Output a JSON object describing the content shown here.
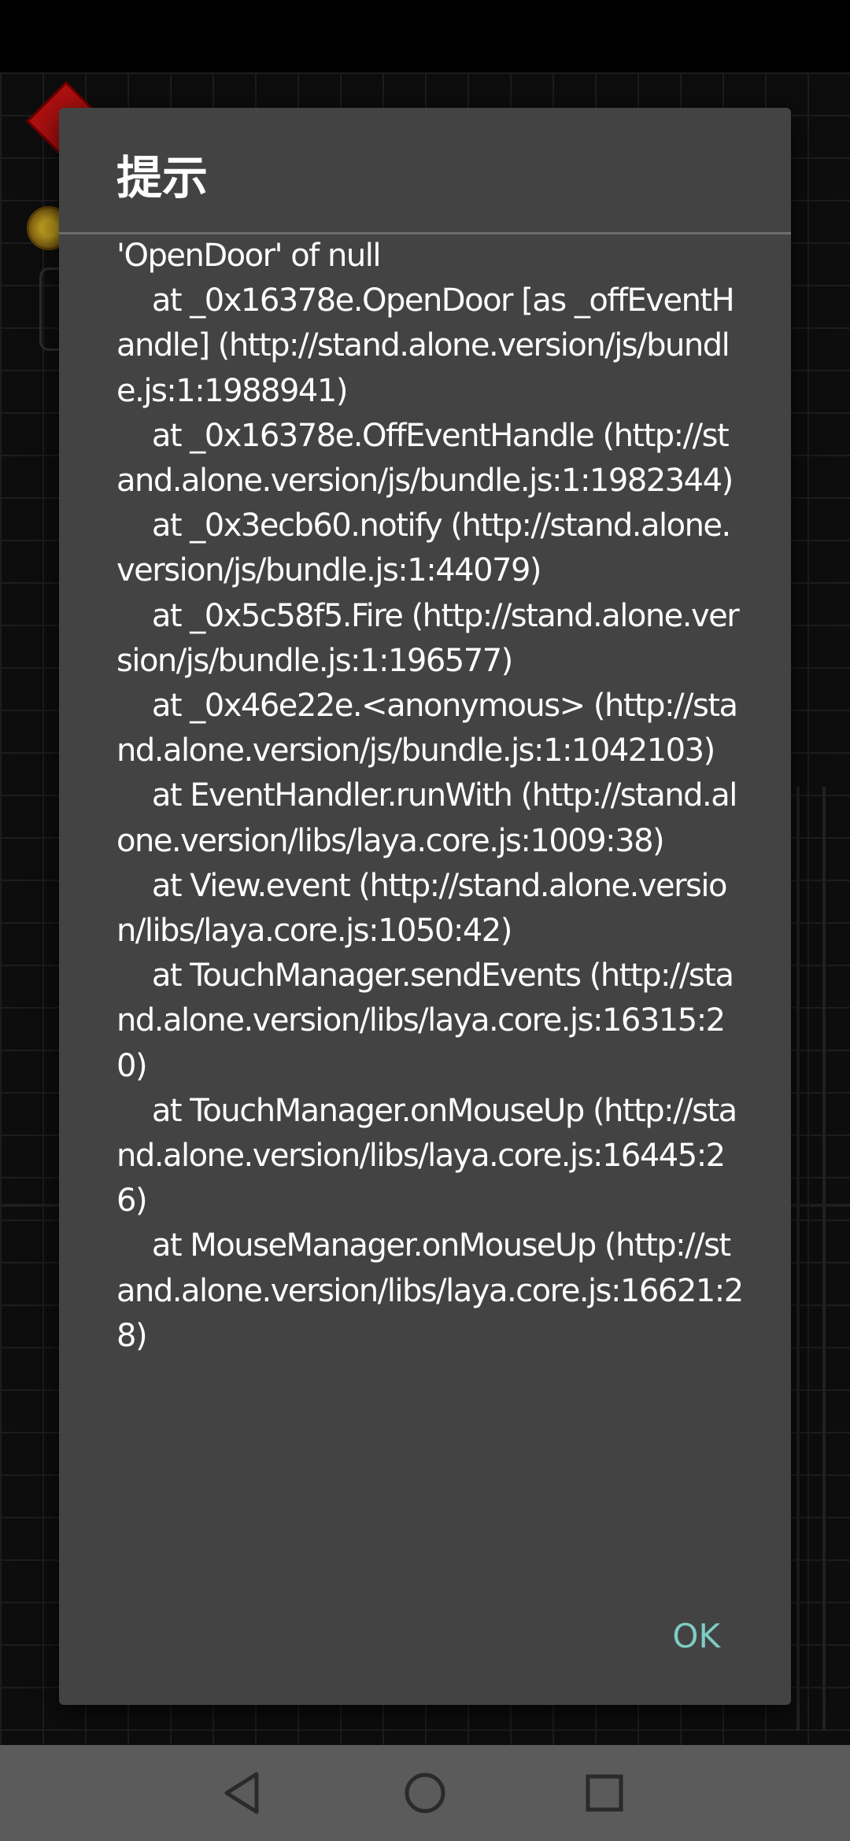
{
  "dialog": {
    "title": "提示",
    "message": "'OpenDoor' of null\n    at _0x16378e.OpenDoor [as _offEventHandle] (http://stand.alone.version/js/bundle.js:1:1988941)\n    at _0x16378e.OffEventHandle (http://stand.alone.version/js/bundle.js:1:1982344)\n    at _0x3ecb60.notify (http://stand.alone.version/js/bundle.js:1:44079)\n    at _0x5c58f5.Fire (http://stand.alone.version/js/bundle.js:1:196577)\n    at _0x46e22e.<anonymous> (http://stand.alone.version/js/bundle.js:1:1042103)\n    at EventHandler.runWith (http://stand.alone.version/libs/laya.core.js:1009:38)\n    at View.event (http://stand.alone.version/libs/laya.core.js:1050:42)\n    at TouchManager.sendEvents (http://stand.alone.version/libs/laya.core.js:16315:20)\n    at TouchManager.onMouseUp (http://stand.alone.version/libs/laya.core.js:16445:26)\n    at MouseManager.onMouseUp (http://stand.alone.version/libs/laya.core.js:16621:28)",
    "ok_label": "OK"
  },
  "nav_bar": {
    "back_icon": "triangle-back-icon",
    "home_icon": "circle-home-icon",
    "recents_icon": "square-recents-icon"
  },
  "colors": {
    "dialog_background": "#434343",
    "accent": "#7fcdc3",
    "nav_bar": "#5b5b5b"
  }
}
